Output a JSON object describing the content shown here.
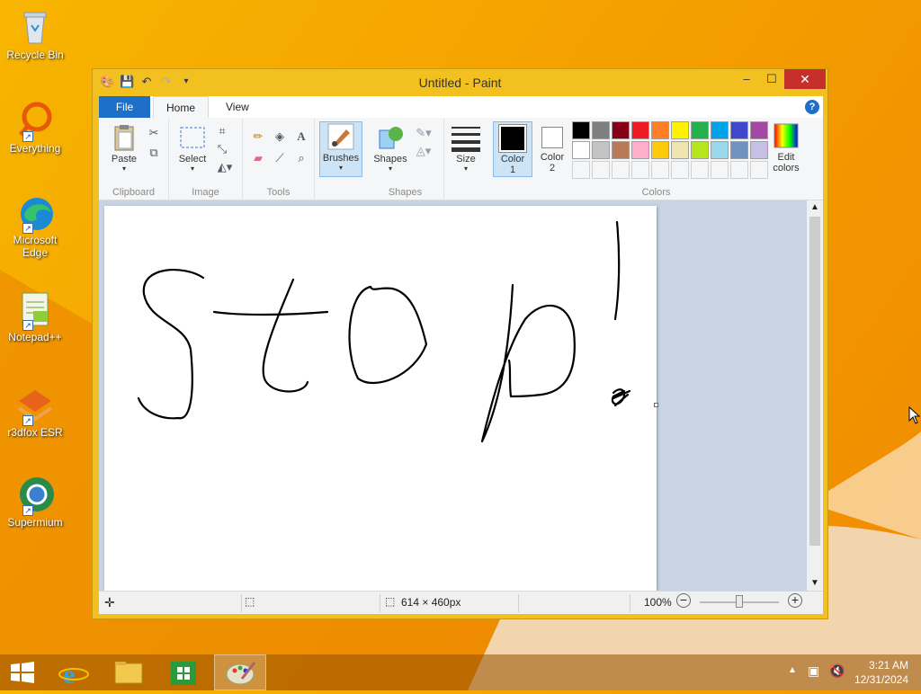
{
  "desktop": {
    "icons": [
      {
        "label": "Recycle Bin"
      },
      {
        "label": "Everything"
      },
      {
        "label": "Microsoft Edge"
      },
      {
        "label": "Notepad++"
      },
      {
        "label": "r3dfox ESR"
      },
      {
        "label": "Supermium"
      }
    ]
  },
  "window": {
    "title": "Untitled - Paint",
    "controls": {
      "minimize": "–",
      "maximize": "☐",
      "close": "✕"
    }
  },
  "tabs": {
    "file": "File",
    "home": "Home",
    "view": "View",
    "help": "?"
  },
  "ribbon": {
    "clipboard": {
      "paste": "Paste",
      "group": "Clipboard"
    },
    "image": {
      "select": "Select",
      "group": "Image"
    },
    "tools": {
      "group": "Tools"
    },
    "brushes": {
      "label": "Brushes"
    },
    "shapes": {
      "label": "Shapes",
      "group": "Shapes"
    },
    "size": {
      "label": "Size"
    },
    "color1": {
      "label": "Color",
      "num": "1"
    },
    "color2": {
      "label": "Color",
      "num": "2"
    },
    "colors": {
      "group": "Colors",
      "edit": "Edit",
      "edit2": "colors"
    },
    "palette_row1": [
      "#000000",
      "#7f7f7f",
      "#880015",
      "#ed1c24",
      "#ff7f27",
      "#fff200",
      "#22b14c",
      "#00a2e8",
      "#3f48cc",
      "#a349a4"
    ],
    "palette_row2": [
      "#ffffff",
      "#c3c3c3",
      "#b97a57",
      "#ffaec9",
      "#ffc90e",
      "#efe4b0",
      "#b5e61d",
      "#99d9ea",
      "#7092be",
      "#c8bfe7"
    ]
  },
  "status": {
    "size": "614 × 460px",
    "zoom": "100%"
  },
  "taskbar": {
    "time": "3:21 AM",
    "date": "12/31/2024"
  }
}
